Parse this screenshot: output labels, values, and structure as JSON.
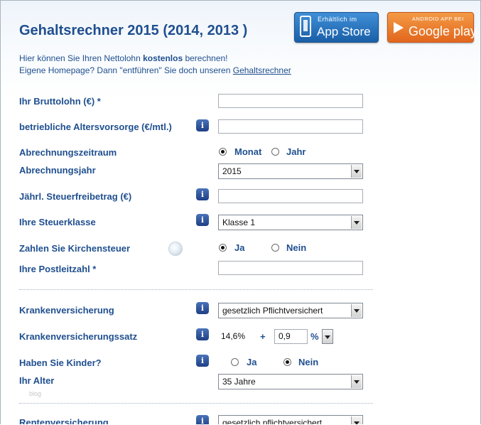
{
  "header": {
    "title": "Gehaltsrechner 2015 (2014, 2013 )",
    "appstore": {
      "small": "Erhältlich im",
      "big": "App Store"
    },
    "googleplay": {
      "small": "ANDROID APP BEI",
      "big": "Google play"
    }
  },
  "intro": {
    "line1_pre": "Hier können Sie Ihren Nettolohn ",
    "line1_bold": "kostenlos",
    "line1_post": " berechnen!",
    "line2_pre": "Eigene Homepage? Dann \"entführen\" Sie doch unseren ",
    "line2_link": "Gehaltsrechner"
  },
  "form": {
    "bruttolohn": {
      "label": "Ihr Bruttolohn (€) *",
      "value": ""
    },
    "altersvorsorge": {
      "label": "betriebliche Altersvorsorge (€/mtl.)",
      "value": ""
    },
    "zeitraum": {
      "label": "Abrechnungszeitraum",
      "opt1": "Monat",
      "opt2": "Jahr",
      "selected": "Monat"
    },
    "jahr": {
      "label": "Abrechnungsjahr",
      "value": "2015"
    },
    "freibetrag": {
      "label": "Jährl. Steuerfreibetrag (€)",
      "value": ""
    },
    "steuerklasse": {
      "label": "Ihre Steuerklasse",
      "value": "Klasse 1"
    },
    "kirchensteuer": {
      "label": "Zahlen Sie Kirchensteuer",
      "opt1": "Ja",
      "opt2": "Nein",
      "selected": "Ja"
    },
    "plz": {
      "label": "Ihre Postleitzahl *",
      "value": ""
    },
    "kv": {
      "label": "Krankenversicherung",
      "value": "gesetzlich Pflichtversichert"
    },
    "kvsatz": {
      "label": "Krankenversicherungssatz",
      "base": "14,6%",
      "plus": "+",
      "zusatz": "0,9",
      "unit": "%"
    },
    "kinder": {
      "label": "Haben Sie Kinder?",
      "opt1": "Ja",
      "opt2": "Nein",
      "selected": "Nein"
    },
    "alter": {
      "label": "Ihr Alter",
      "value": "35 Jahre"
    },
    "rv": {
      "label": "Rentenversicherung",
      "value": "gesetzlich pflichtversichert"
    }
  },
  "info_glyph": "i",
  "faint_text": "blog"
}
